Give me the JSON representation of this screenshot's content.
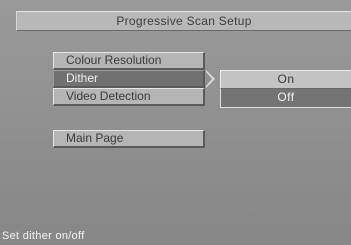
{
  "title": "Progressive Scan Setup",
  "menu": {
    "items": [
      {
        "label": "Colour Resolution"
      },
      {
        "label": "Dither"
      },
      {
        "label": "Video Detection"
      },
      {
        "label": "Main Page"
      }
    ],
    "selected": "Dither"
  },
  "submenu": {
    "options": [
      {
        "label": "On"
      },
      {
        "label": "Off"
      }
    ],
    "selected": "Off"
  },
  "status_text": "Set dither on/off",
  "colors": {
    "background": "#8f8f8f",
    "button": "#b5b5b5",
    "button_selected": "#717171",
    "status_text": "#f4f4f4"
  }
}
